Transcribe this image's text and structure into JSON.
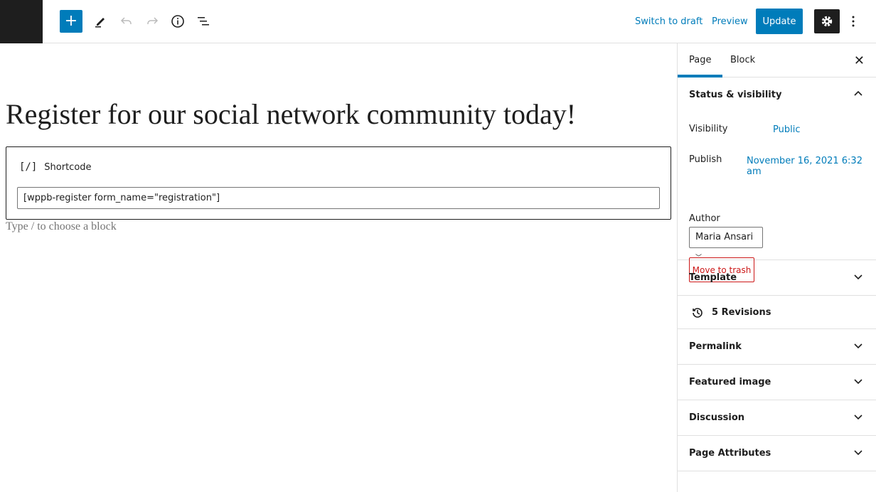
{
  "toolbar": {
    "add_icon": "plus-icon",
    "switch_to_draft": "Switch to draft",
    "preview": "Preview",
    "update": "Update",
    "accent": "#007cba"
  },
  "editor": {
    "title": "Register for our social network community today!",
    "block_name": "Shortcode",
    "block_icon": "shortcode-icon",
    "shortcode": "[wppb-register form_name=\"registration\"]",
    "appender_placeholder": "Type / to choose a block"
  },
  "sidebar": {
    "tabs": [
      "Page",
      "Block"
    ],
    "status_title": "Status & visibility",
    "visibility_label": "Visibility",
    "visibility_value": "Public",
    "publish_label": "Publish",
    "publish_value": "November 16, 2021 6:32 am",
    "author_label": "Author",
    "author_value": "Maria Ansari",
    "trash": "Move to trash",
    "panels": [
      "Template",
      "5 Revisions",
      "Permalink",
      "Featured image",
      "Discussion",
      "Page Attributes"
    ]
  }
}
